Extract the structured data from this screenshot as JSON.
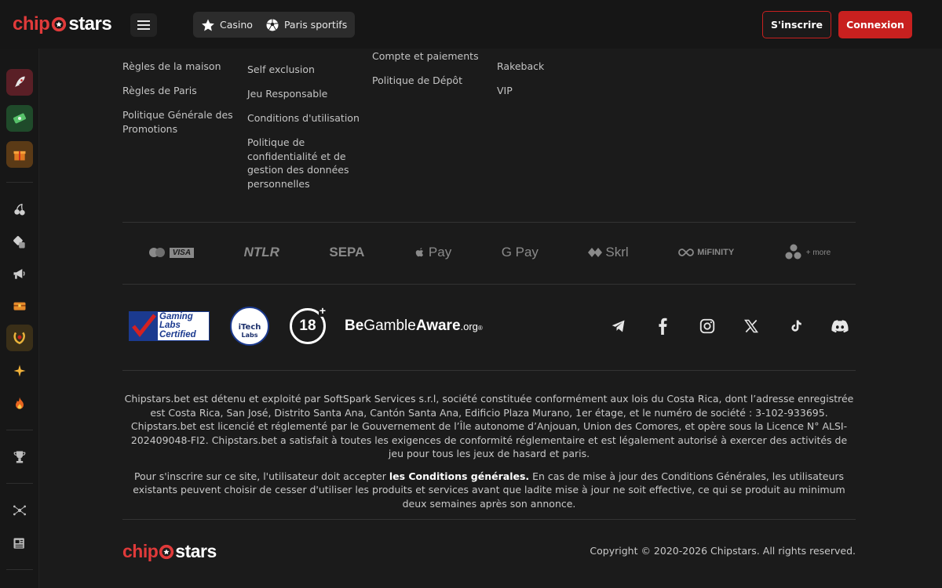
{
  "header": {
    "logo": {
      "part1": "chip",
      "part2": "stars"
    },
    "nav": [
      {
        "label": "Casino",
        "icon": "star-icon"
      },
      {
        "label": "Paris sportifs",
        "icon": "soccer-ball-icon"
      }
    ],
    "register_label": "S'inscrire",
    "login_label": "Connexion"
  },
  "footer": {
    "columns": [
      {
        "links": [
          "Règles de la maison",
          "Règles de Paris",
          "Politique Générale des Promotions"
        ]
      },
      {
        "links": [
          "Self exclusion",
          "Jeu Responsable",
          "Conditions d'utilisation",
          "Politique de confidentialité et de gestion des données personnelles"
        ]
      },
      {
        "links": [
          "Compte et paiements",
          "Politique de Dépôt"
        ]
      },
      {
        "links": [
          "Rakeback",
          "VIP"
        ]
      }
    ],
    "payments": [
      "VISA",
      "NTLR",
      "SEPA",
      "Pay",
      "G Pay",
      "Skrl",
      "MiFINITY",
      "+ more"
    ],
    "certs": {
      "gaming_labs": [
        "Gaming",
        "Labs",
        "Certified"
      ],
      "itech": [
        "iTech",
        "Labs"
      ],
      "age": "18",
      "begamble": {
        "be": "Be",
        "gamble": "Gamble",
        "aware": "Aware",
        "org": ".org"
      }
    },
    "legal": {
      "p1": "Chipstars.bet est détenu et exploité par SoftSpark Services s.r.l, société constituée conformément aux lois du Costa Rica, dont l’adresse enregistrée est Costa Rica, San José, Distrito Santa Ana, Cantón Santa Ana, Edificio Plaza Murano, 1er étage, et le numéro de société : 3-102-933695. Chipstars.bet est licencié et réglementé par le Gouvernement de l’Île autonome d’Anjouan, Union des Comores, et opère sous la Licence N° ALSI-202409048-FI2. Chipstars.bet a satisfait à toutes les exigences de conformité réglementaire et est légalement autorisé à exercer des activités de jeu pour tous les jeux de hasard et paris.",
      "p2_before": "Pour s'inscrire sur ce site, l'utilisateur doit accepter ",
      "p2_bold": "les Conditions générales.",
      "p2_after": " En cas de mise à jour des Conditions Générales, les utilisateurs existants peuvent choisir de cesser d'utiliser les produits et services avant que ladite mise à jour ne soit effective, ce qui se produit au minimum deux semaines après son annonce."
    },
    "copyright": "Copyright © 2020-2026 Chipstars. All rights reserved."
  },
  "colors": {
    "accent": "#c8201f",
    "background": "#1b1b1b",
    "header": "#161616"
  }
}
